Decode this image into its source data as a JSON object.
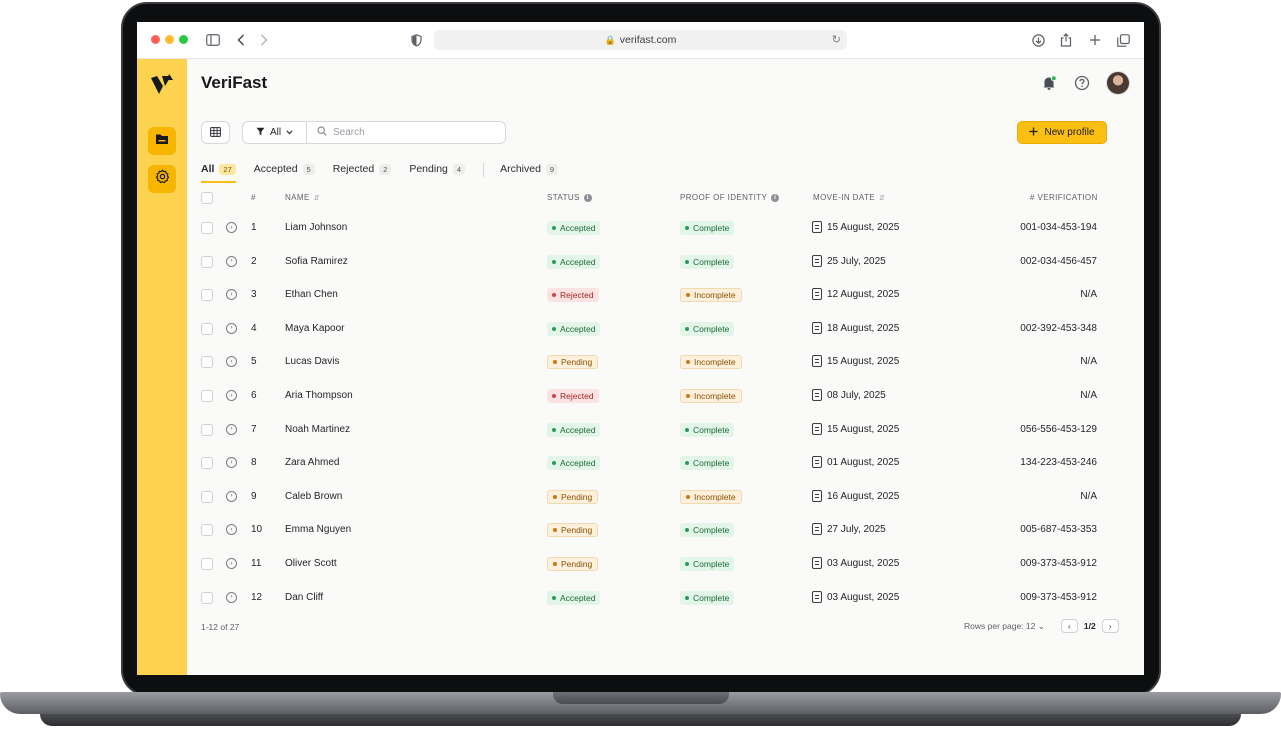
{
  "browser": {
    "url": "verifast.com"
  },
  "app": {
    "title": "VeriFast"
  },
  "toolbar": {
    "filter_value": "All",
    "search_placeholder": "Search",
    "new_button": "New profile"
  },
  "tabs": [
    {
      "label": "All",
      "count": "27"
    },
    {
      "label": "Accepted",
      "count": "5"
    },
    {
      "label": "Rejected",
      "count": "2"
    },
    {
      "label": "Pending",
      "count": "4"
    },
    {
      "label": "Archived",
      "count": "9"
    }
  ],
  "columns": {
    "num": "#",
    "name": "NAME",
    "status": "STATUS",
    "proof": "PROOF OF IDENTITY",
    "move_in": "MOVE-IN DATE",
    "verification": "# VERIFICATION"
  },
  "rows": [
    {
      "num": "1",
      "name": "Liam Johnson",
      "status": "Accepted",
      "proof": "Complete",
      "date": "15 August, 2025",
      "verification": "001-034-453-194"
    },
    {
      "num": "2",
      "name": "Sofia Ramirez",
      "status": "Accepted",
      "proof": "Complete",
      "date": "25 July, 2025",
      "verification": "002-034-456-457"
    },
    {
      "num": "3",
      "name": "Ethan Chen",
      "status": "Rejected",
      "proof": "Incomplete",
      "date": "12 August, 2025",
      "verification": "N/A"
    },
    {
      "num": "4",
      "name": "Maya Kapoor",
      "status": "Accepted",
      "proof": "Complete",
      "date": "18 August, 2025",
      "verification": "002-392-453-348"
    },
    {
      "num": "5",
      "name": "Lucas Davis",
      "status": "Pending",
      "proof": "Incomplete",
      "date": "15 August, 2025",
      "verification": "N/A"
    },
    {
      "num": "6",
      "name": "Aria Thompson",
      "status": "Rejected",
      "proof": "Incomplete",
      "date": "08 July, 2025",
      "verification": "N/A"
    },
    {
      "num": "7",
      "name": "Noah Martinez",
      "status": "Accepted",
      "proof": "Complete",
      "date": "15 August, 2025",
      "verification": "056-556-453-129"
    },
    {
      "num": "8",
      "name": "Zara Ahmed",
      "status": "Accepted",
      "proof": "Complete",
      "date": "01 August, 2025",
      "verification": "134-223-453-246"
    },
    {
      "num": "9",
      "name": "Caleb Brown",
      "status": "Pending",
      "proof": "Incomplete",
      "date": "16 August, 2025",
      "verification": "N/A"
    },
    {
      "num": "10",
      "name": "Emma Nguyen",
      "status": "Pending",
      "proof": "Complete",
      "date": "27 July, 2025",
      "verification": "005-687-453-353"
    },
    {
      "num": "11",
      "name": "Oliver Scott",
      "status": "Pending",
      "proof": "Complete",
      "date": "03 August, 2025",
      "verification": "009-373-453-912"
    },
    {
      "num": "12",
      "name": "Dan Cliff",
      "status": "Accepted",
      "proof": "Complete",
      "date": "03 August, 2025",
      "verification": "009-373-453-912"
    }
  ],
  "footer": {
    "count": "1-12 of 27",
    "rows_per_page": "Rows per page: 12",
    "page": "1/2"
  },
  "colors": {
    "accent": "#fbbf14",
    "sidebar": "#fdd24f"
  }
}
